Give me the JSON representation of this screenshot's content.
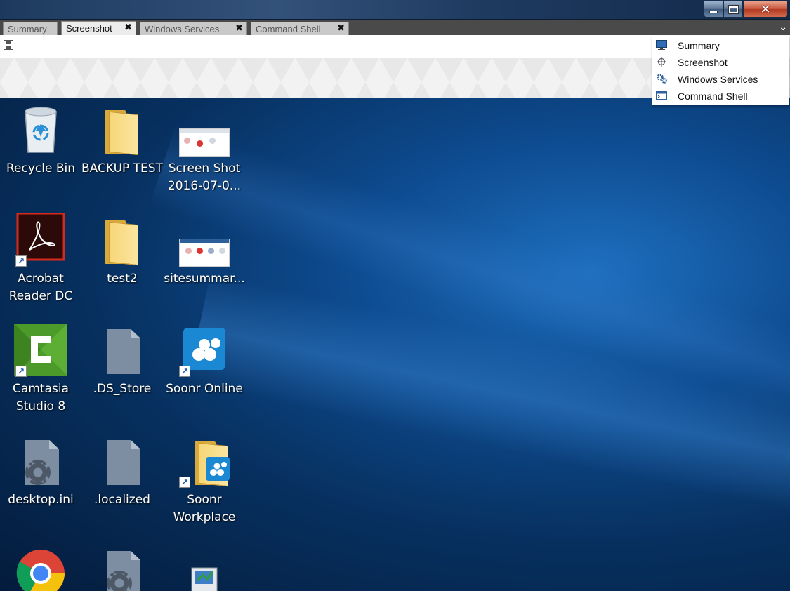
{
  "tabs": [
    {
      "label": "Summary",
      "closable": false,
      "active": false
    },
    {
      "label": "Screenshot",
      "closable": true,
      "active": true
    },
    {
      "label": "Windows Services",
      "closable": true,
      "active": false
    },
    {
      "label": "Command Shell",
      "closable": true,
      "active": false
    }
  ],
  "tab_close_glyph": "✖",
  "tab_dropdown_glyph": "⌄",
  "window_controls": {
    "close_glyph": "✕"
  },
  "menu": {
    "items": [
      {
        "label": "Summary",
        "icon": "monitor-icon"
      },
      {
        "label": "Screenshot",
        "icon": "crosshair-icon"
      },
      {
        "label": "Windows Services",
        "icon": "gears-icon"
      },
      {
        "label": "Command Shell",
        "icon": "terminal-window-icon"
      }
    ]
  },
  "desktop": {
    "icons": [
      {
        "label": "Recycle Bin",
        "icon": "recycle-bin-icon"
      },
      {
        "label": "BACKUP TEST",
        "icon": "folder-icon"
      },
      {
        "label": "Screen Shot 2016-07-0...",
        "icon": "image-thumbnail-icon"
      },
      {
        "label": "Acrobat Reader DC",
        "icon": "acrobat-icon",
        "shortcut": true
      },
      {
        "label": "test2",
        "icon": "folder-icon"
      },
      {
        "label": "sitesummar...",
        "icon": "image-thumbnail-icon"
      },
      {
        "label": "Camtasia Studio 8",
        "icon": "camtasia-icon",
        "shortcut": true
      },
      {
        "label": ".DS_Store",
        "icon": "file-icon"
      },
      {
        "label": "Soonr Online",
        "icon": "soonr-icon",
        "shortcut": true
      },
      {
        "label": "desktop.ini",
        "icon": "settings-file-icon"
      },
      {
        "label": ".localized",
        "icon": "file-icon"
      },
      {
        "label": "Soonr Workplace",
        "icon": "soonr-folder-icon",
        "shortcut": true
      }
    ]
  },
  "colors": {
    "tabstrip_bg": "#4a4a4a",
    "desktop_accent": "#1e6fbf",
    "close_button": "#c9583f"
  }
}
